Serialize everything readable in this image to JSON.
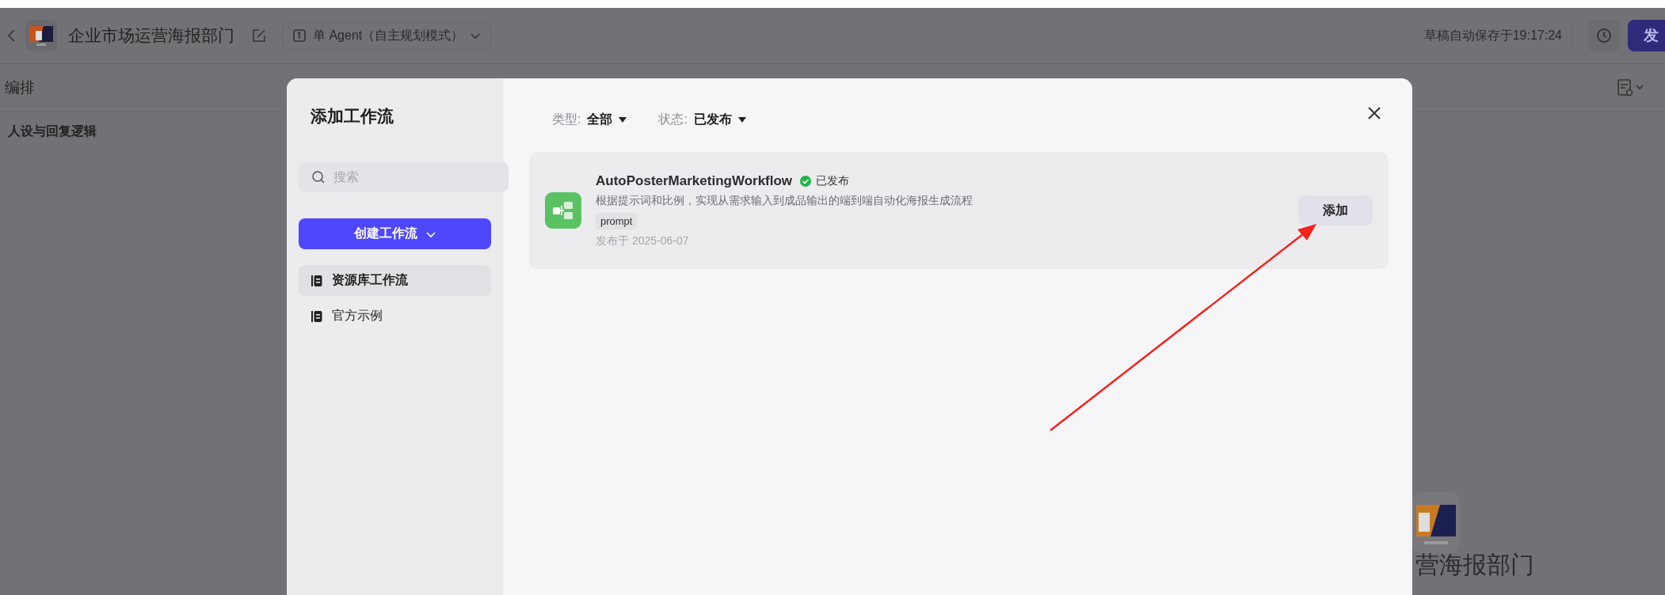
{
  "header": {
    "title": "企业市场运营海报部门",
    "mode": "单 Agent（自主规划模式）",
    "autosave": "草稿自动保存于19:17:24",
    "publish": "发"
  },
  "toolbar": {
    "title": "编排"
  },
  "sections": [
    "人设与回复逻辑"
  ],
  "background_card": {
    "label": "营海报部门"
  },
  "dialog": {
    "title": "添加工作流",
    "search": {
      "placeholder": "搜索"
    },
    "create_button": "创建工作流",
    "nav": [
      {
        "label": "资源库工作流",
        "selected": true
      },
      {
        "label": "官方示例",
        "selected": false
      }
    ],
    "filters": [
      {
        "label": "类型:",
        "value": "全部"
      },
      {
        "label": "状态:",
        "value": "已发布"
      }
    ],
    "workflows": [
      {
        "name": "AutoPosterMarketingWorkflow",
        "status": "已发布",
        "description": "根据提示词和比例，实现从需求输入到成品输出的端到端自动化海报生成流程",
        "tags": [
          "prompt"
        ],
        "date": "发布于 2025-06-07",
        "action": "添加"
      }
    ]
  }
}
